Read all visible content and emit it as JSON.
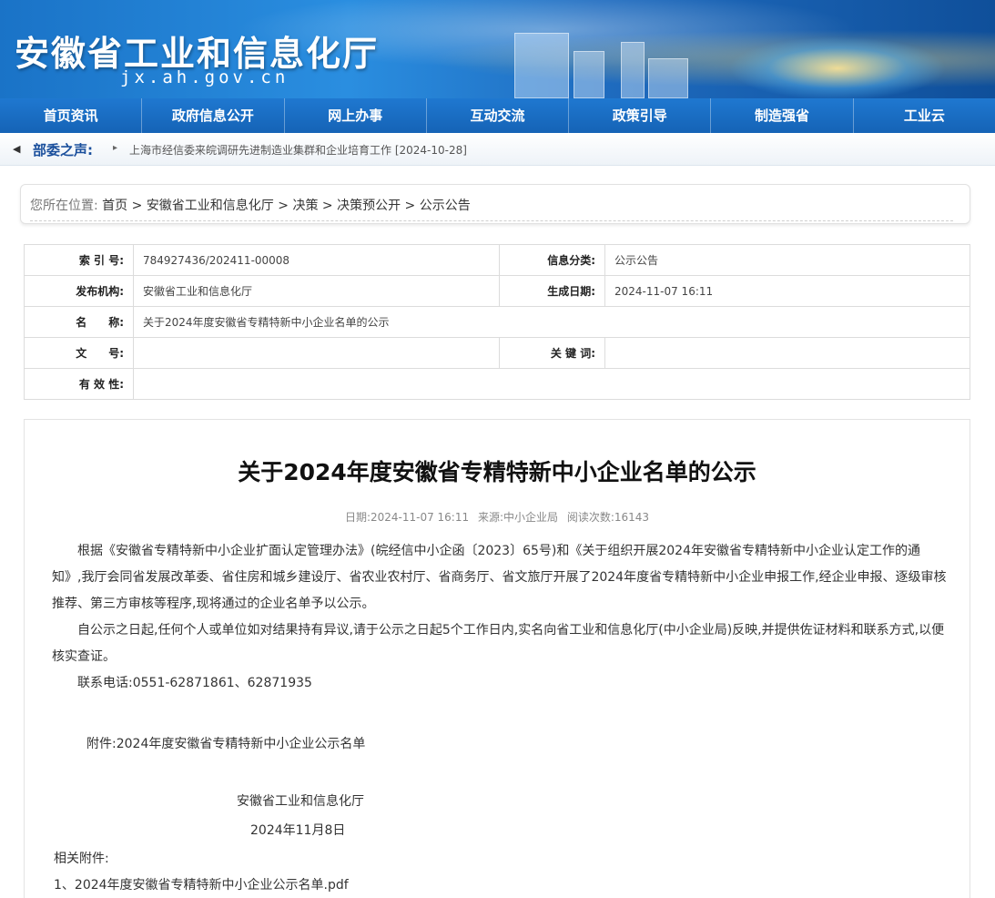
{
  "header": {
    "site_title": "安徽省工业和信息化厅",
    "domain": "jx.ah.gov.cn"
  },
  "nav": {
    "items": [
      "首页资讯",
      "政府信息公开",
      "网上办事",
      "互动交流",
      "政策引导",
      "制造强省",
      "工业云"
    ]
  },
  "ticker": {
    "label": "部委之声:",
    "news": "上海市经信委来皖调研先进制造业集群和企业培育工作 [2024-10-28]"
  },
  "breadcrumb": {
    "prefix": "您所在位置:",
    "items": [
      "首页",
      "安徽省工业和信息化厅",
      "决策",
      "决策预公开",
      "公示公告"
    ]
  },
  "info": {
    "index_label": "索 引 号:",
    "index_value": "784927436/202411-00008",
    "category_label": "信息分类:",
    "category_value": "公示公告",
    "publisher_label": "发布机构:",
    "publisher_value": "安徽省工业和信息化厅",
    "date_label": "生成日期:",
    "date_value": "2024-11-07 16:11",
    "name_label": "名　　称:",
    "name_value": "关于2024年度安徽省专精特新中小企业名单的公示",
    "docno_label": "文　　号:",
    "docno_value": "",
    "keywords_label": "关 键 词:",
    "keywords_value": "",
    "validity_label": "有 效 性:",
    "validity_value": ""
  },
  "article": {
    "title": "关于2024年度安徽省专精特新中小企业名单的公示",
    "meta_date": "日期:2024-11-07 16:11",
    "meta_source": "来源:中小企业局",
    "meta_views": "阅读次数:16143",
    "para1": "根据《安徽省专精特新中小企业扩面认定管理办法》(皖经信中小企函〔2023〕65号)和《关于组织开展2024年安徽省专精特新中小企业认定工作的通知》,我厅会同省发展改革委、省住房和城乡建设厅、省农业农村厅、省商务厅、省文旅厅开展了2024年度省专精特新中小企业申报工作,经企业申报、逐级审核推荐、第三方审核等程序,现将通过的企业名单予以公示。",
    "para2": "自公示之日起,任何个人或单位如对结果持有异议,请于公示之日起5个工作日内,实名向省工业和信息化厅(中小企业局)反映,并提供佐证材料和联系方式,以便核实查证。",
    "contact": "联系电话:0551-62871861、62871935",
    "attachment": "附件:2024年度安徽省专精特新中小企业公示名单",
    "sign_org": "安徽省工业和信息化厅",
    "sign_date": "2024年11月8日",
    "related_label": "相关附件:",
    "related_file": "1、2024年度安徽省专精特新中小企业公示名单.pdf"
  }
}
